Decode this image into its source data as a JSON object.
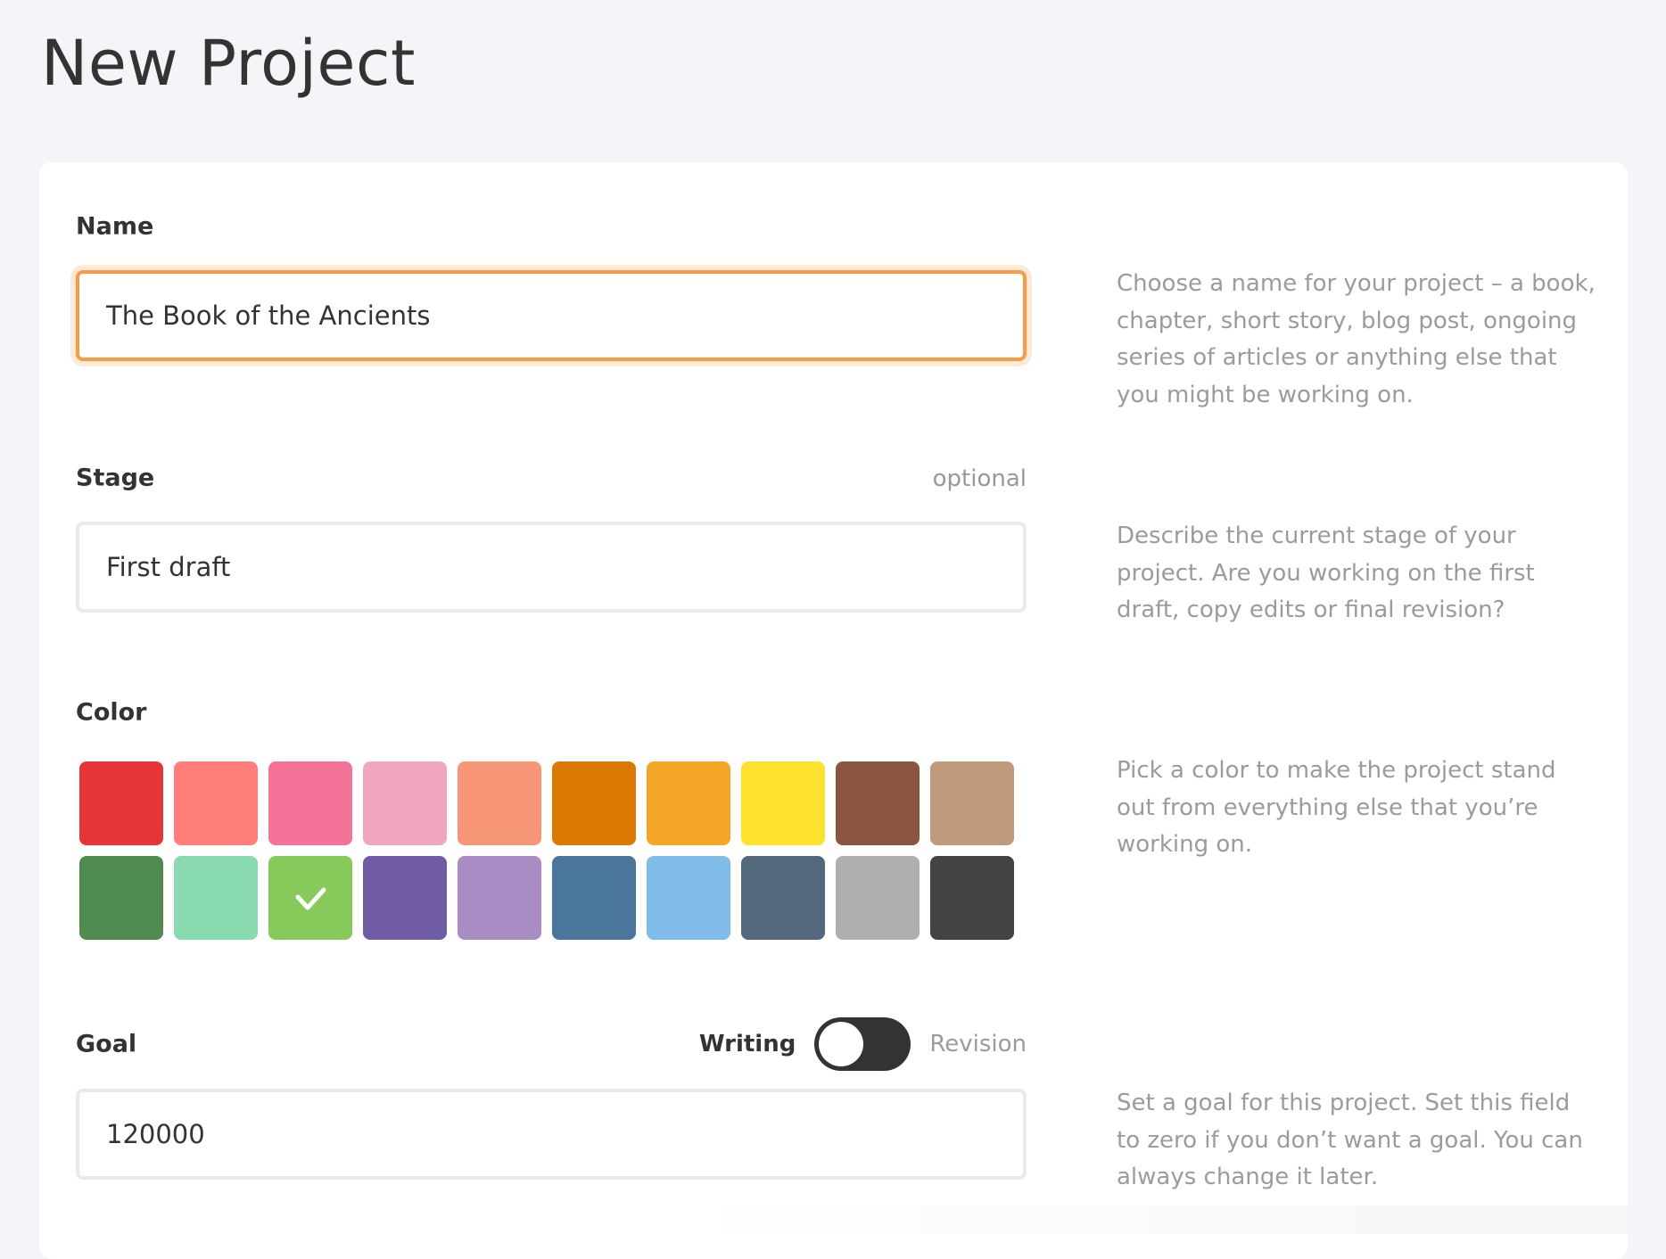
{
  "page": {
    "title": "New Project"
  },
  "form": {
    "name": {
      "label": "Name",
      "value": "The Book of the Ancients",
      "help": "Choose a name for your project – a book, chapter, short story, blog post, ongoing series of articles or anything else that you might be working on."
    },
    "stage": {
      "label": "Stage",
      "optional_label": "optional",
      "value": "First draft",
      "help": "Describe the current stage of your project. Are you working on the first draft, copy edits or final revision?"
    },
    "color": {
      "label": "Color",
      "selected_index": 12,
      "swatches": [
        {
          "name": "red",
          "hex": "#e63538"
        },
        {
          "name": "salmon",
          "hex": "#ff7e7a"
        },
        {
          "name": "pink",
          "hex": "#f37399"
        },
        {
          "name": "light-pink",
          "hex": "#f1a6c0"
        },
        {
          "name": "peach",
          "hex": "#f89777"
        },
        {
          "name": "dark-orange",
          "hex": "#db7904"
        },
        {
          "name": "orange",
          "hex": "#f6a627"
        },
        {
          "name": "yellow",
          "hex": "#fce22c"
        },
        {
          "name": "brown",
          "hex": "#8b5640"
        },
        {
          "name": "tan",
          "hex": "#bf9a7b"
        },
        {
          "name": "green",
          "hex": "#4f8b4f"
        },
        {
          "name": "mint",
          "hex": "#8adaaf"
        },
        {
          "name": "lime",
          "hex": "#87c95b"
        },
        {
          "name": "purple",
          "hex": "#6f5ca5"
        },
        {
          "name": "lavender",
          "hex": "#aa8cc5"
        },
        {
          "name": "steel-blue",
          "hex": "#4a769c"
        },
        {
          "name": "sky-blue",
          "hex": "#80bcea"
        },
        {
          "name": "slate",
          "hex": "#53687d"
        },
        {
          "name": "gray",
          "hex": "#afafaf"
        },
        {
          "name": "charcoal",
          "hex": "#434343"
        }
      ],
      "help": "Pick a color to make the project stand out from everything else that you’re working on."
    },
    "goal": {
      "label": "Goal",
      "toggle": {
        "left_label": "Writing",
        "right_label": "Revision",
        "selected": "Writing"
      },
      "value": "120000",
      "help": "Set a goal for this project. Set this field to zero if you don’t want a goal. You can always change it later."
    }
  },
  "colors": {
    "focus_border": "#fb9a45",
    "focus_halo": "#fdebd9",
    "field_border": "#e9eaef",
    "page_background": "#f4f5f8",
    "help_text": "#9b9b9b",
    "text": "#333333"
  }
}
